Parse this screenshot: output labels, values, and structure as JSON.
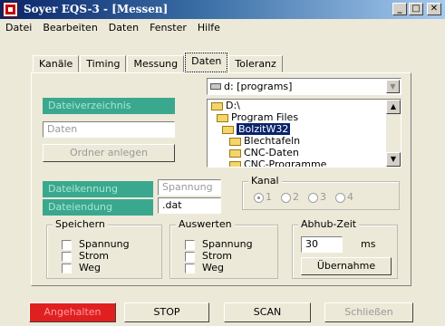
{
  "window": {
    "title": "Soyer EQS-3 - [Messen]",
    "controls": [
      "_",
      "□",
      "✕"
    ]
  },
  "menu": [
    "Datei",
    "Bearbeiten",
    "Daten",
    "Fenster",
    "Hilfe"
  ],
  "tabs": [
    "Kanäle",
    "Timing",
    "Messung",
    "Daten",
    "Toleranz"
  ],
  "active_tab": "Daten",
  "daten": {
    "dir_label": "Dateiverzeichnis",
    "dir_value": "Daten",
    "create_folder": "Ordner anlegen",
    "drive": "d: [programs]",
    "folders": [
      {
        "name": "D:\\",
        "selected": false
      },
      {
        "name": "Program Files",
        "selected": false
      },
      {
        "name": "BolzitW32",
        "selected": true
      },
      {
        "name": "Blechtafeln",
        "selected": false
      },
      {
        "name": "CNC-Daten",
        "selected": false
      },
      {
        "name": "CNC-Programme",
        "selected": false
      }
    ],
    "file_id_label": "Dateikennung",
    "file_id_value": "Spannung",
    "file_ext_label": "Dateiendung",
    "file_ext_value": ".dat"
  },
  "kanal": {
    "title": "Kanal",
    "options": [
      "1",
      "2",
      "3",
      "4"
    ],
    "selected": "1"
  },
  "speichern": {
    "title": "Speichern",
    "items": [
      "Spannung",
      "Strom",
      "Weg"
    ]
  },
  "auswerten": {
    "title": "Auswerten",
    "items": [
      "Spannung",
      "Strom",
      "Weg"
    ]
  },
  "abhub": {
    "title": "Abhub-Zeit",
    "value": "30",
    "unit": "ms",
    "button": "Übernahme"
  },
  "buttons": {
    "status": "Angehalten",
    "stop": "STOP",
    "scan": "SCAN",
    "close": "Schließen"
  }
}
